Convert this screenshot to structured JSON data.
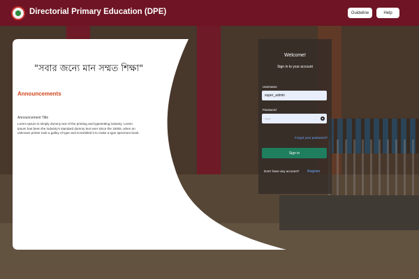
{
  "header": {
    "title": "Directorial Primary Education (DPE)",
    "buttons": {
      "guideline": "Guideline",
      "help": "Help"
    }
  },
  "hero": {
    "quote": "\"সবার জন্যে মান সম্মত শিক্ষা\""
  },
  "announcements": {
    "heading": "Announcements",
    "item_title": "Announcement Title",
    "item_body": "Lorem Ipsum is simply dummy text of the printing and typesetting industry. Lorem Ipsum has been the industry's standard dummy text ever since the 1500s, when an unknown printer took a galley of type and scrambled it to make a type specimen book."
  },
  "login": {
    "welcome": "Welcome!",
    "subtitle": "Sign in to your account",
    "username_label": "Username",
    "username_value": "super_admin",
    "password_label": "Password",
    "password_value": "......",
    "forgot": "Forgot your password?",
    "submit": "Sign in",
    "no_account": "Don't have any account?",
    "register": "Register"
  },
  "colors": {
    "header_bg": "#6e1424",
    "accent_orange": "#d0451b",
    "signin_green": "#1e7e5e",
    "link_blue": "#6aa8ff"
  }
}
